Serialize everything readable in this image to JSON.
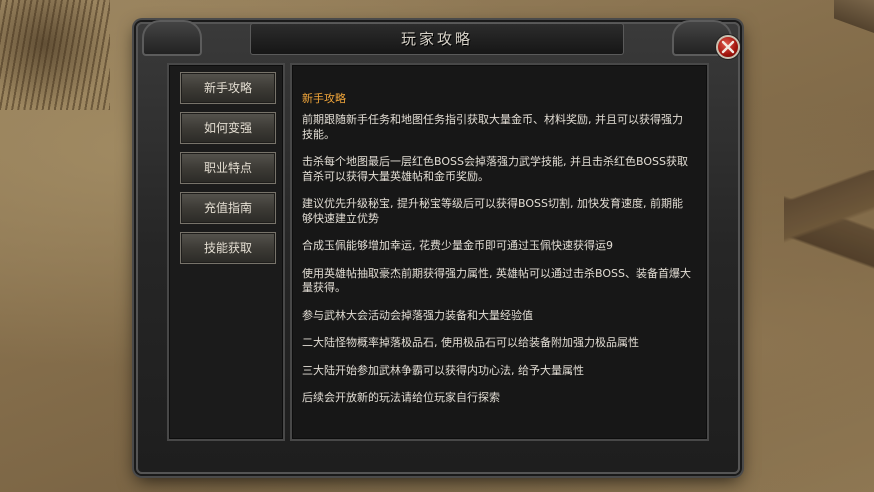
{
  "window": {
    "title": "玩家攻略"
  },
  "nav": {
    "items": [
      {
        "label": "新手攻略"
      },
      {
        "label": "如何变强"
      },
      {
        "label": "职业特点"
      },
      {
        "label": "充值指南"
      },
      {
        "label": "技能获取"
      }
    ]
  },
  "content": {
    "heading": "新手攻略",
    "tips": [
      "前期跟随新手任务和地图任务指引获取大量金币、材料奖励, 并且可以获得强力技能。",
      "击杀每个地图最后一层红色BOSS会掉落强力武学技能, 并且击杀红色BOSS获取首杀可以获得大量英雄帖和金币奖励。",
      "建议优先升级秘宝, 提升秘宝等级后可以获得BOSS切割, 加快发育速度, 前期能够快速建立优势",
      "合成玉佩能够增加幸运, 花费少量金币即可通过玉佩快速获得运9",
      "使用英雄帖抽取豪杰前期获得强力属性, 英雄帖可以通过击杀BOSS、装备首爆大量获得。",
      "参与武林大会活动会掉落强力装备和大量经验值",
      "二大陆怪物概率掉落极品石, 使用极品石可以给装备附加强力极品属性",
      "三大陆开始参加武林争霸可以获得内功心法, 给予大量属性",
      "后续会开放新的玩法请给位玩家自行探索"
    ]
  },
  "icons": {
    "close": "close-icon"
  },
  "colors": {
    "heading": "#f0a53a",
    "text": "#e2ddd4",
    "close_button": "#b3170e"
  }
}
